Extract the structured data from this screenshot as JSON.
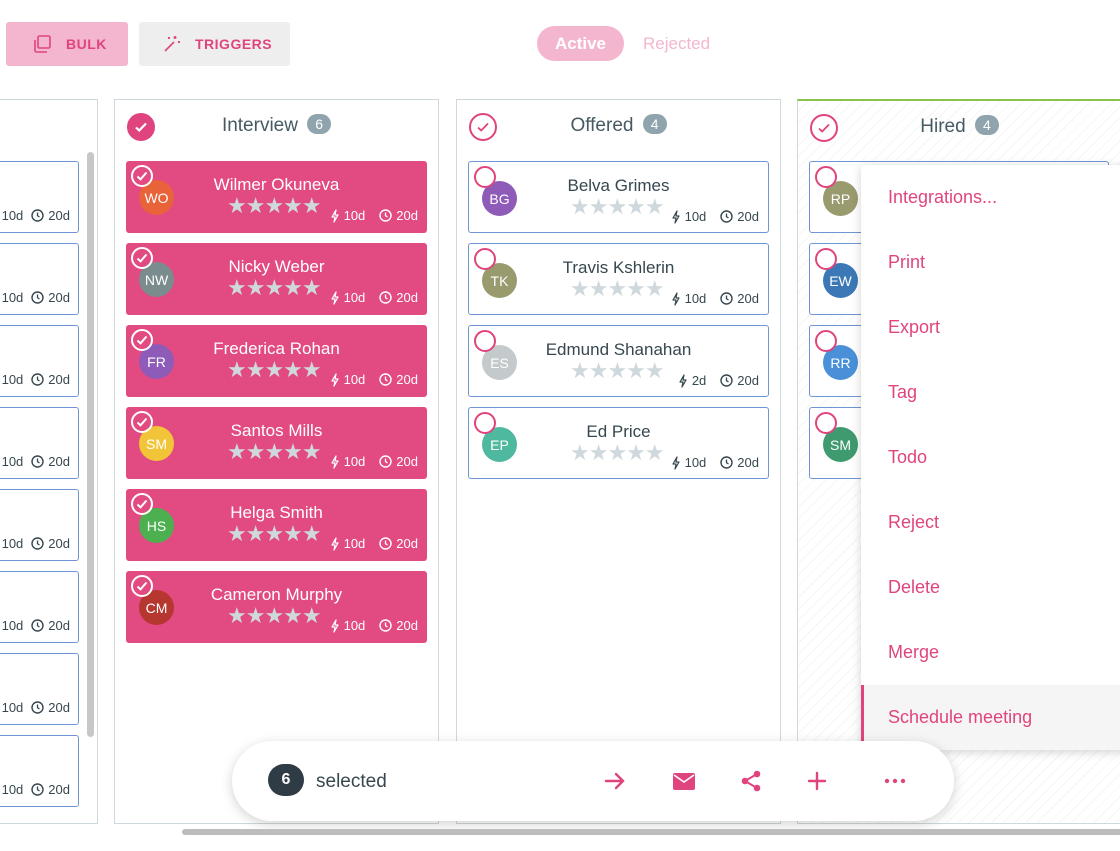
{
  "toolbar": {
    "bulk_label": "BULK",
    "triggers_label": "TRIGGERS",
    "filter_active": "Active",
    "filter_rejected": "Rejected"
  },
  "colors": {
    "accent": "#e0447e",
    "accent_light": "#f4b6ce",
    "selected_card": "#e24a82",
    "hired_top": "#8bc34a"
  },
  "left_column": {
    "cards": [
      {
        "days_stage": "10d",
        "days_total": "20d"
      },
      {
        "days_stage": "10d",
        "days_total": "20d"
      },
      {
        "days_stage": "10d",
        "days_total": "20d"
      },
      {
        "days_stage": "10d",
        "days_total": "20d"
      },
      {
        "days_stage": "10d",
        "days_total": "20d"
      },
      {
        "days_stage": "10d",
        "days_total": "20d"
      },
      {
        "days_stage": "10d",
        "days_total": "20d"
      },
      {
        "days_stage": "10d",
        "days_total": "20d"
      }
    ]
  },
  "columns": [
    {
      "title": "Interview",
      "count": "6",
      "all_selected": true,
      "cards": [
        {
          "name": "Wilmer Okuneva",
          "initials": "WO",
          "avatar_color": "#e8623a",
          "days_stage": "10d",
          "days_total": "20d",
          "selected": true
        },
        {
          "name": "Nicky Weber",
          "initials": "NW",
          "avatar_color": "#7b8c8f",
          "days_stage": "10d",
          "days_total": "20d",
          "selected": true
        },
        {
          "name": "Frederica Rohan",
          "initials": "FR",
          "avatar_color": "#8e5bb8",
          "days_stage": "10d",
          "days_total": "20d",
          "selected": true
        },
        {
          "name": "Santos Mills",
          "initials": "SM",
          "avatar_color": "#f2c538",
          "days_stage": "10d",
          "days_total": "20d",
          "selected": true
        },
        {
          "name": "Helga Smith",
          "initials": "HS",
          "avatar_color": "#4caf50",
          "days_stage": "10d",
          "days_total": "20d",
          "selected": true
        },
        {
          "name": "Cameron Murphy",
          "initials": "CM",
          "avatar_color": "#b5372f",
          "days_stage": "10d",
          "days_total": "20d",
          "selected": true
        }
      ]
    },
    {
      "title": "Offered",
      "count": "4",
      "all_selected": false,
      "cards": [
        {
          "name": "Belva Grimes",
          "initials": "BG",
          "avatar_color": "#8e5bb8",
          "days_stage": "10d",
          "days_total": "20d",
          "selected": false
        },
        {
          "name": "Travis Kshlerin",
          "initials": "TK",
          "avatar_color": "#9a9a6f",
          "days_stage": "10d",
          "days_total": "20d",
          "selected": false
        },
        {
          "name": "Edmund Shanahan",
          "initials": "ES",
          "avatar_color": "#c4c9cc",
          "days_stage": "2d",
          "days_total": "20d",
          "selected": false
        },
        {
          "name": "Ed Price",
          "initials": "EP",
          "avatar_color": "#4fb99f",
          "days_stage": "10d",
          "days_total": "20d",
          "selected": false
        }
      ]
    },
    {
      "title": "Hired",
      "count": "4",
      "all_selected": false,
      "cards": [
        {
          "initials": "RP",
          "avatar_color": "#9a9a6f"
        },
        {
          "initials": "EW",
          "avatar_color": "#3b78b5"
        },
        {
          "initials": "RR",
          "avatar_color": "#4a90d9"
        },
        {
          "initials": "SM",
          "avatar_color": "#3f9a6f"
        }
      ]
    }
  ],
  "menu": {
    "items": [
      "Integrations...",
      "Print",
      "Export",
      "Tag",
      "Todo",
      "Reject",
      "Delete",
      "Merge",
      "Schedule meeting"
    ],
    "highlighted": "Schedule meeting"
  },
  "selection_bar": {
    "count": "6",
    "label": "selected",
    "actions": [
      "arrow-right-icon",
      "envelope-icon",
      "share-icon",
      "plus-icon",
      "more-icon"
    ]
  }
}
